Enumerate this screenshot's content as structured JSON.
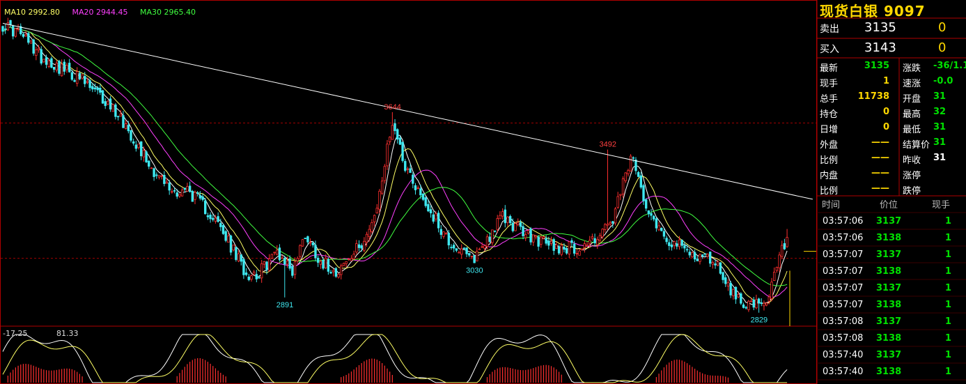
{
  "ma_legend": {
    "ma10": "MA10 2992.80",
    "ma20": "MA20 2944.45",
    "ma30": "MA30 2965.40"
  },
  "macd_legend": {
    "v1": "-17.25",
    "v2": "81.33"
  },
  "colors": {
    "up": "#ff2f2f",
    "down": "#3fe8f0",
    "ma10": "#ffff66",
    "ma20": "#ff40ff",
    "ma30": "#40ff40",
    "ma5": "#ffffff",
    "grid": "#a00000",
    "price_green": "#00e000",
    "price_yellow": "#ffd800"
  },
  "chart_data": {
    "type": "candlestick",
    "annotations": [
      {
        "label": "3644",
        "kind": "high"
      },
      {
        "label": "3492",
        "kind": "high"
      },
      {
        "label": "2891",
        "kind": "low"
      },
      {
        "label": "3030",
        "kind": "low"
      },
      {
        "label": "2829",
        "kind": "low"
      }
    ],
    "swing_points": [
      {
        "i": 0,
        "v": 4000
      },
      {
        "i": 7,
        "v": 3960
      },
      {
        "i": 15,
        "v": 3870
      },
      {
        "i": 30,
        "v": 3780
      },
      {
        "i": 45,
        "v": 3640
      },
      {
        "i": 58,
        "v": 3420
      },
      {
        "i": 66,
        "v": 3320
      },
      {
        "i": 72,
        "v": 3330
      },
      {
        "i": 82,
        "v": 3220
      },
      {
        "i": 95,
        "v": 2990
      },
      {
        "i": 100,
        "v": 2990
      },
      {
        "i": 107,
        "v": 3080
      },
      {
        "i": 113,
        "v": 3000
      },
      {
        "i": 118,
        "v": 3150
      },
      {
        "i": 124,
        "v": 3040
      },
      {
        "i": 130,
        "v": 3000
      },
      {
        "i": 136,
        "v": 3050
      },
      {
        "i": 145,
        "v": 3200
      },
      {
        "i": 152,
        "v": 3610
      },
      {
        "i": 157,
        "v": 3430
      },
      {
        "i": 164,
        "v": 3290
      },
      {
        "i": 174,
        "v": 3120
      },
      {
        "i": 183,
        "v": 3040
      },
      {
        "i": 195,
        "v": 3220
      },
      {
        "i": 205,
        "v": 3140
      },
      {
        "i": 215,
        "v": 3100
      },
      {
        "i": 225,
        "v": 3090
      },
      {
        "i": 232,
        "v": 3140
      },
      {
        "i": 238,
        "v": 3200
      },
      {
        "i": 245,
        "v": 3460
      },
      {
        "i": 252,
        "v": 3250
      },
      {
        "i": 258,
        "v": 3140
      },
      {
        "i": 268,
        "v": 3070
      },
      {
        "i": 278,
        "v": 3040
      },
      {
        "i": 285,
        "v": 2900
      },
      {
        "i": 292,
        "v": 2860
      },
      {
        "i": 298,
        "v": 2850
      },
      {
        "i": 302,
        "v": 3020
      },
      {
        "i": 306,
        "v": 3135
      }
    ],
    "special_bars": [
      {
        "i": 110,
        "low": 2891
      },
      {
        "i": 152,
        "high": 3644
      },
      {
        "i": 184,
        "low": 3030
      },
      {
        "i": 236,
        "high": 3492
      },
      {
        "i": 295,
        "low": 2829
      }
    ],
    "ylim": [
      2780,
      4060
    ],
    "reference_lines": [
      3600,
      3050
    ],
    "trendline": {
      "from": [
        0,
        4005
      ],
      "to": [
        316,
        3290
      ]
    },
    "last_price": 3135
  },
  "quote": {
    "title": "现货白银 9097",
    "sell_label": "卖出",
    "sell_price": "3135",
    "sell_qty": "0",
    "buy_label": "买入",
    "buy_price": "3143",
    "buy_qty": "0"
  },
  "info_left": [
    {
      "label": "最新",
      "value": "3135",
      "color": "g"
    },
    {
      "label": "现手",
      "value": "1",
      "color": "y"
    },
    {
      "label": "总手",
      "value": "11738",
      "color": "y"
    },
    {
      "label": "持仓",
      "value": "0",
      "color": "y"
    },
    {
      "label": "日增",
      "value": "0",
      "color": "y"
    },
    {
      "label": "外盘",
      "value": "——",
      "color": "y"
    },
    {
      "label": "比例",
      "value": "——",
      "color": "y"
    },
    {
      "label": "内盘",
      "value": "——",
      "color": "y"
    },
    {
      "label": "比例",
      "value": "——",
      "color": "y"
    }
  ],
  "info_right": [
    {
      "label": "涨跌",
      "value": "-36/1.1",
      "color": "g"
    },
    {
      "label": "速涨",
      "value": "-0.0",
      "color": "g"
    },
    {
      "label": "开盘",
      "value": "31",
      "color": "g"
    },
    {
      "label": "最高",
      "value": "32",
      "color": "g"
    },
    {
      "label": "最低",
      "value": "31",
      "color": "g"
    },
    {
      "label": "结算价",
      "value": "31",
      "color": "g"
    },
    {
      "label": "昨收",
      "value": "31",
      "color": "w"
    },
    {
      "label": "涨停",
      "value": "",
      "color": "w"
    },
    {
      "label": "跌停",
      "value": "",
      "color": "w"
    }
  ],
  "trades_header": {
    "time": "时间",
    "price": "价位",
    "qty": "现手"
  },
  "trades": [
    {
      "time": "03:57:06",
      "price": "3137",
      "qty": "1",
      "color": "g"
    },
    {
      "time": "03:57:06",
      "price": "3138",
      "qty": "1",
      "color": "r"
    },
    {
      "time": "03:57:07",
      "price": "3137",
      "qty": "1",
      "color": "g"
    },
    {
      "time": "03:57:07",
      "price": "3138",
      "qty": "1",
      "color": "r"
    },
    {
      "time": "03:57:07",
      "price": "3137",
      "qty": "1",
      "color": "g"
    },
    {
      "time": "03:57:07",
      "price": "3138",
      "qty": "1",
      "color": "r"
    },
    {
      "time": "03:57:08",
      "price": "3137",
      "qty": "1",
      "color": "g"
    },
    {
      "time": "03:57:08",
      "price": "3138",
      "qty": "1",
      "color": "r"
    },
    {
      "time": "03:57:40",
      "price": "3137",
      "qty": "1",
      "color": "g"
    },
    {
      "time": "03:57:40",
      "price": "3138",
      "qty": "1",
      "color": "r"
    }
  ]
}
